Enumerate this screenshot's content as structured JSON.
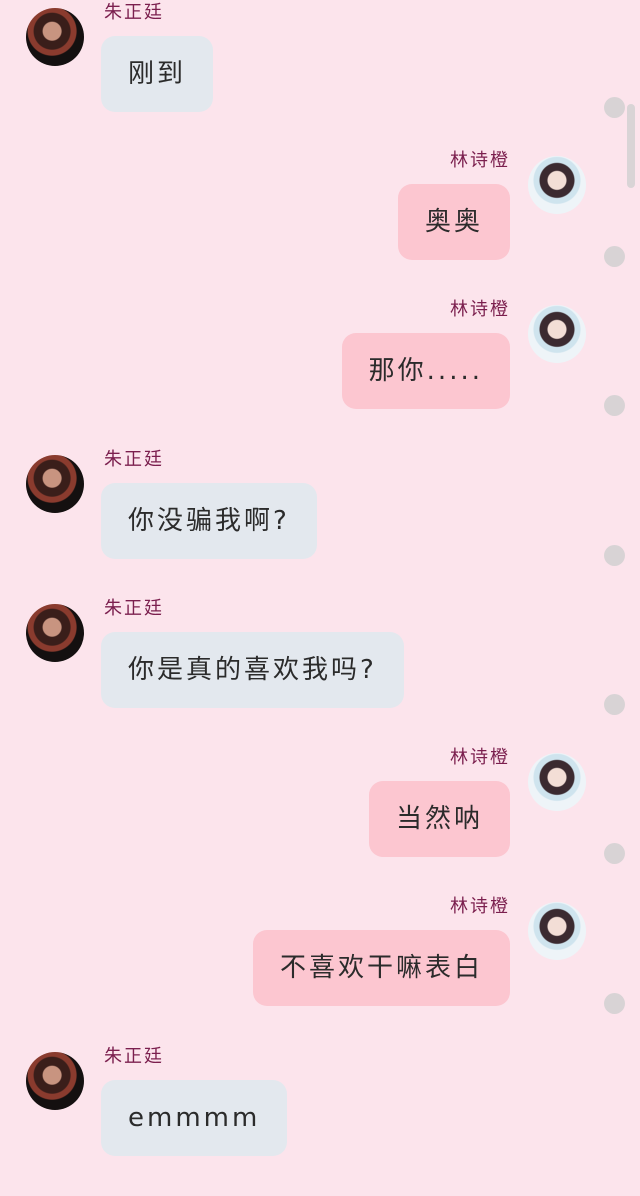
{
  "chat": {
    "messages": [
      {
        "side": "left",
        "sender": "朱正廷",
        "avatar_icon": "avatar-zhu",
        "text": "刚到"
      },
      {
        "side": "right",
        "sender": "林诗橙",
        "avatar_icon": "avatar-lin",
        "text": "奥奥"
      },
      {
        "side": "right",
        "sender": "林诗橙",
        "avatar_icon": "avatar-lin",
        "text": "那你....."
      },
      {
        "side": "left",
        "sender": "朱正廷",
        "avatar_icon": "avatar-zhu",
        "text": "你没骗我啊?"
      },
      {
        "side": "left",
        "sender": "朱正廷",
        "avatar_icon": "avatar-zhu",
        "text": "你是真的喜欢我吗?"
      },
      {
        "side": "right",
        "sender": "林诗橙",
        "avatar_icon": "avatar-lin",
        "text": "当然呐"
      },
      {
        "side": "right",
        "sender": "林诗橙",
        "avatar_icon": "avatar-lin",
        "text": "不喜欢干嘛表白"
      },
      {
        "side": "left",
        "sender": "朱正廷",
        "avatar_icon": "avatar-zhu",
        "text": "emmmm"
      }
    ]
  },
  "colors": {
    "background": "#fce4ec",
    "left_bubble": "#e3e8ee",
    "right_bubble": "#fcc6d0",
    "sender_name": "#7b1f4e"
  }
}
